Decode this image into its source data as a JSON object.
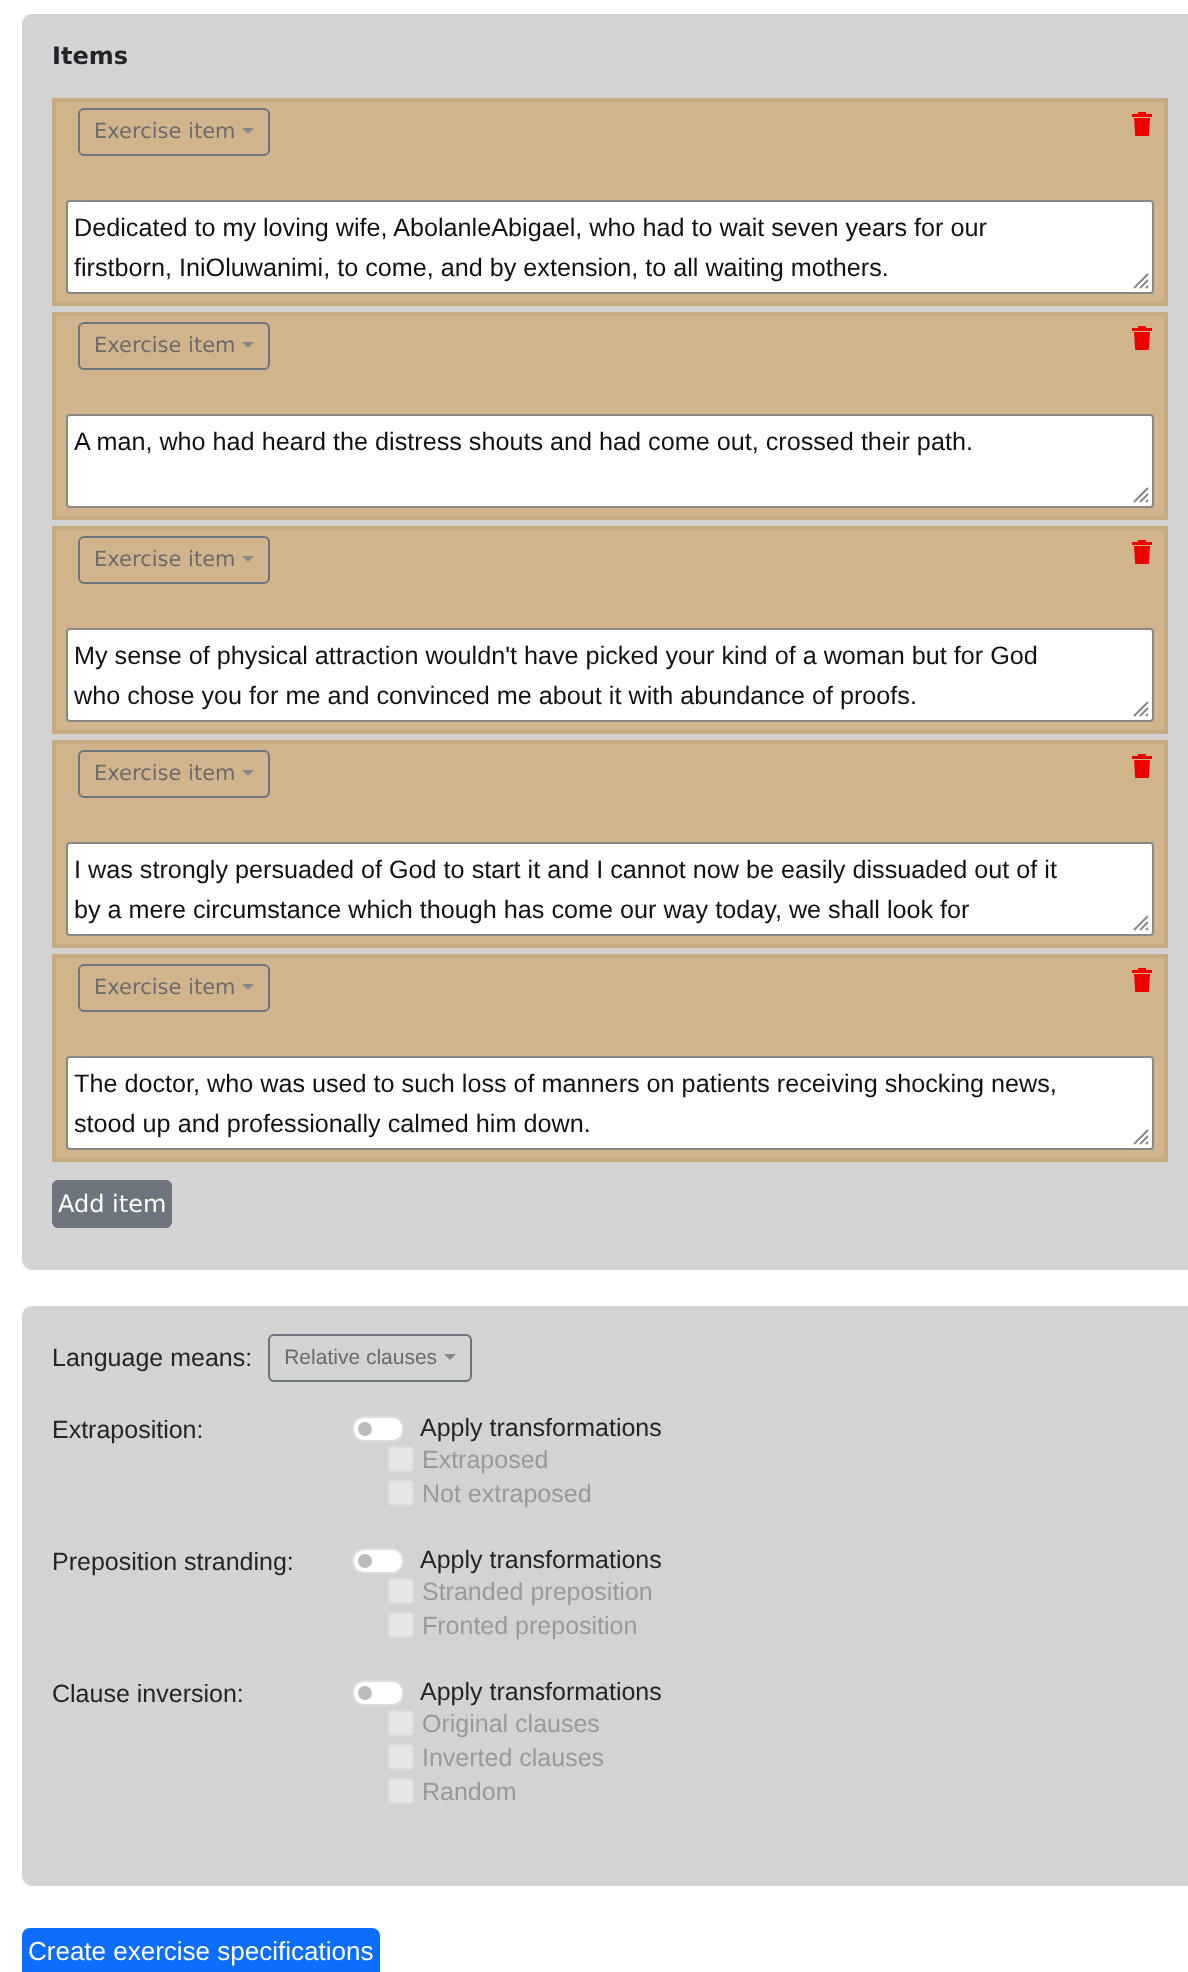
{
  "items_panel": {
    "title": "Items",
    "items": [
      {
        "type_dropdown": "Exercise item",
        "text": "Dedicated to my loving wife, AbolanleAbigael, who had to wait seven years for our firstborn, IniOluwanimi, to come, and by extension, to all waiting mothers."
      },
      {
        "type_dropdown": "Exercise item",
        "text": "A man, who had heard the distress shouts and had come out, crossed their path."
      },
      {
        "type_dropdown": "Exercise item",
        "text": "My sense of physical attraction wouldn't have picked your kind of a woman but for God who chose you for me and convinced me about it with abundance of proofs."
      },
      {
        "type_dropdown": "Exercise item",
        "text": "I was strongly persuaded of God to start it and I cannot now be easily dissuaded out of it by a mere circumstance which though has come our way today, we shall look for"
      },
      {
        "type_dropdown": "Exercise item",
        "text": "The doctor, who was used to such loss of manners on patients receiving shocking news, stood up and professionally calmed him down."
      }
    ],
    "add_button": "Add item"
  },
  "settings_panel": {
    "language_means_label": "Language means:",
    "language_means_dropdown": "Relative clauses",
    "groups": [
      {
        "label": "Extraposition:",
        "toggle": {
          "label": "Apply transformations",
          "on": false
        },
        "options": [
          {
            "label": "Extraposed",
            "checked": false,
            "disabled": true
          },
          {
            "label": "Not extraposed",
            "checked": false,
            "disabled": true
          }
        ]
      },
      {
        "label": "Preposition stranding:",
        "toggle": {
          "label": "Apply transformations",
          "on": false
        },
        "options": [
          {
            "label": "Stranded preposition",
            "checked": false,
            "disabled": true
          },
          {
            "label": "Fronted preposition",
            "checked": false,
            "disabled": true
          }
        ]
      },
      {
        "label": "Clause inversion:",
        "toggle": {
          "label": "Apply transformations",
          "on": false
        },
        "options": [
          {
            "label": "Original clauses",
            "checked": false,
            "disabled": true
          },
          {
            "label": "Inverted clauses",
            "checked": false,
            "disabled": true
          },
          {
            "label": "Random",
            "checked": false,
            "disabled": true
          }
        ]
      }
    ]
  },
  "create_button": "Create exercise specifications"
}
